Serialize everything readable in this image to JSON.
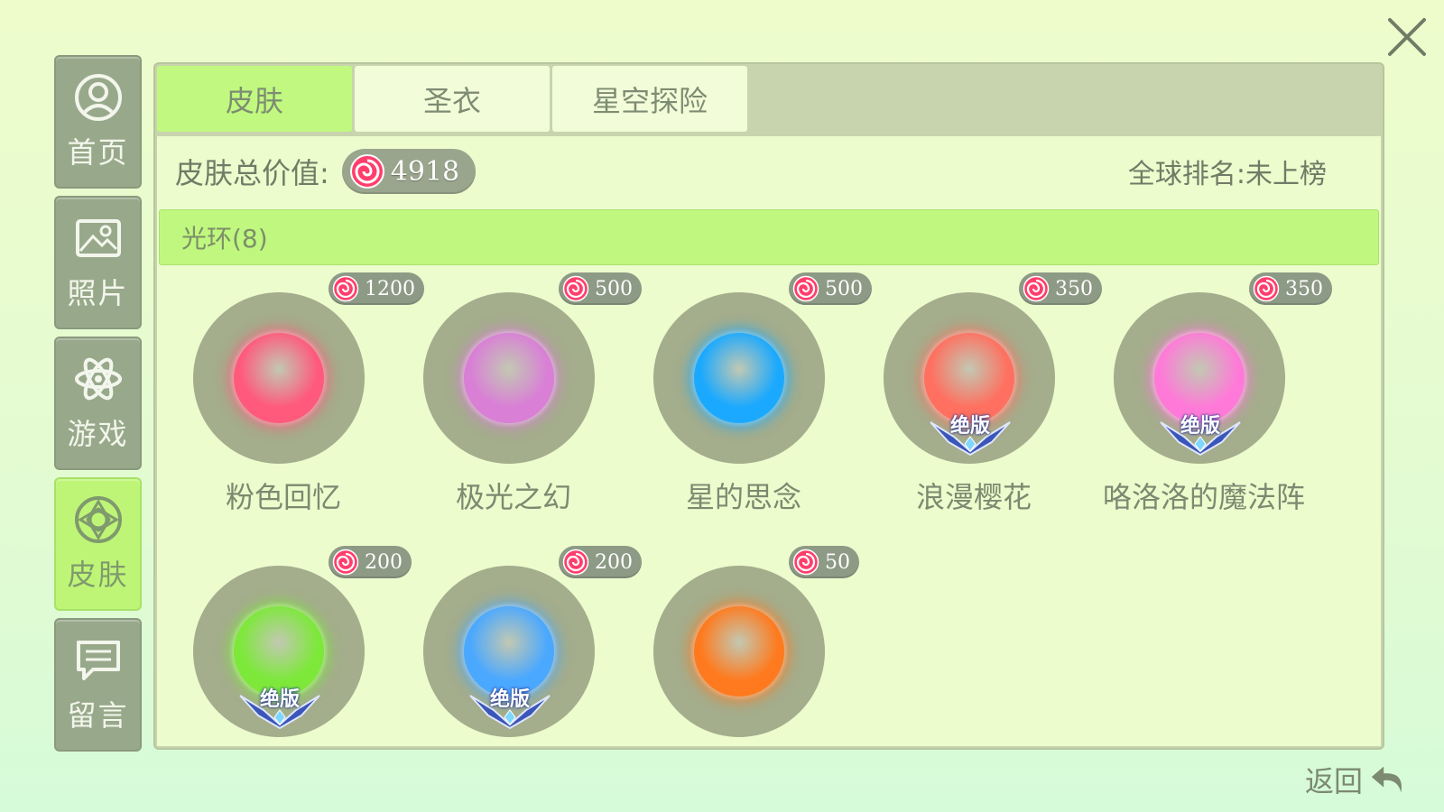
{
  "sidebar": {
    "items": [
      {
        "label": "首页",
        "icon": "user-circle-icon"
      },
      {
        "label": "照片",
        "icon": "image-icon"
      },
      {
        "label": "游戏",
        "icon": "atom-icon"
      },
      {
        "label": "皮肤",
        "icon": "star-ring-icon",
        "active": true
      },
      {
        "label": "留言",
        "icon": "message-icon"
      }
    ]
  },
  "tabs": [
    {
      "label": "皮肤",
      "active": true
    },
    {
      "label": "圣衣"
    },
    {
      "label": "星空探险"
    }
  ],
  "summary": {
    "total_label": "皮肤总价值:",
    "total_value": "4918",
    "rank_text": "全球排名:未上榜"
  },
  "category": {
    "label": "光环(8)"
  },
  "items": [
    {
      "name": "粉色回忆",
      "price": "1200",
      "badge": "",
      "color": "#ff5a7c"
    },
    {
      "name": "极光之幻",
      "price": "500",
      "badge": "",
      "color": "#d97fd6"
    },
    {
      "name": "星的思念",
      "price": "500",
      "badge": "",
      "color": "#1aa9ff"
    },
    {
      "name": "浪漫樱花",
      "price": "350",
      "badge": "绝版",
      "color": "#ff7060"
    },
    {
      "name": "咯洛洛的魔法阵",
      "price": "350",
      "badge": "绝版",
      "color": "#ff7ad8"
    },
    {
      "name": "",
      "price": "200",
      "badge": "绝版",
      "color": "#7de83a"
    },
    {
      "name": "",
      "price": "200",
      "badge": "绝版",
      "color": "#4aa8ff"
    },
    {
      "name": "",
      "price": "50",
      "badge": "",
      "color": "#ff7a1e"
    }
  ],
  "footer": {
    "back_label": "返回"
  },
  "colors": {
    "accent": "#c1f87f",
    "sidebar": "#98a98b",
    "pill": "#8d9a86"
  }
}
